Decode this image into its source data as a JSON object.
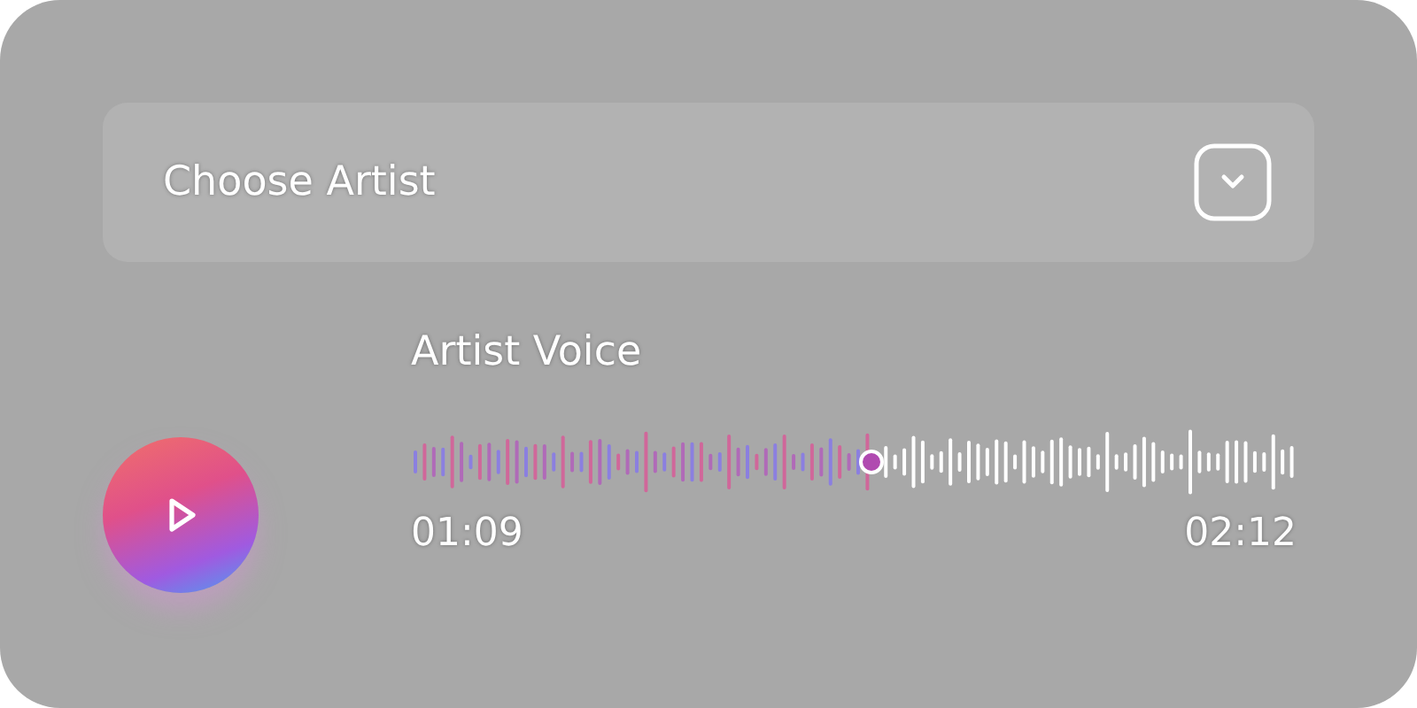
{
  "dropdown": {
    "label": "Choose Artist"
  },
  "player": {
    "title": "Artist Voice",
    "playing": false,
    "level": 0.52,
    "elapsed": "01:09",
    "duration": "02:12"
  }
}
